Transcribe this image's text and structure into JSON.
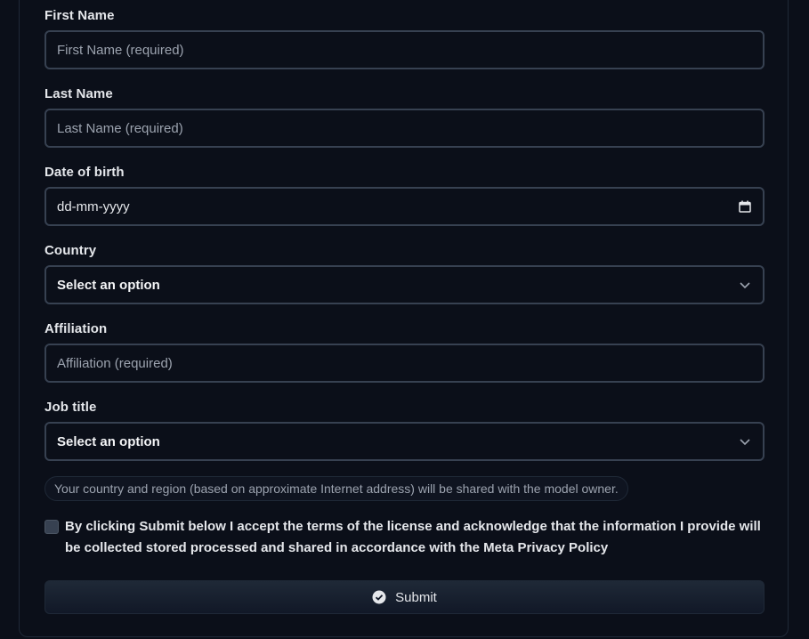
{
  "form": {
    "first_name": {
      "label": "First Name",
      "placeholder": "First Name (required)"
    },
    "last_name": {
      "label": "Last Name",
      "placeholder": "Last Name (required)"
    },
    "dob": {
      "label": "Date of birth",
      "value": "dd-mm-yyyy",
      "icon": "calendar-icon"
    },
    "country": {
      "label": "Country",
      "selected": "Select an option",
      "icon": "chevron-down-icon"
    },
    "affiliation": {
      "label": "Affiliation",
      "placeholder": "Affiliation (required)"
    },
    "job_title": {
      "label": "Job title",
      "selected": "Select an option",
      "icon": "chevron-down-icon"
    },
    "note": "Your country and region (based on approximate Internet address) will be shared with the model owner.",
    "consent": {
      "checked": false,
      "text": "By clicking Submit below I accept the terms of the license and acknowledge that the information I provide will be collected stored processed and shared in accordance with the Meta Privacy Policy"
    },
    "submit": {
      "label": "Submit",
      "icon": "check-circle-icon"
    }
  },
  "colors": {
    "background": "#0b0f19",
    "border": "#374151",
    "text": "#e5e7eb",
    "placeholder": "#9ca3af"
  }
}
